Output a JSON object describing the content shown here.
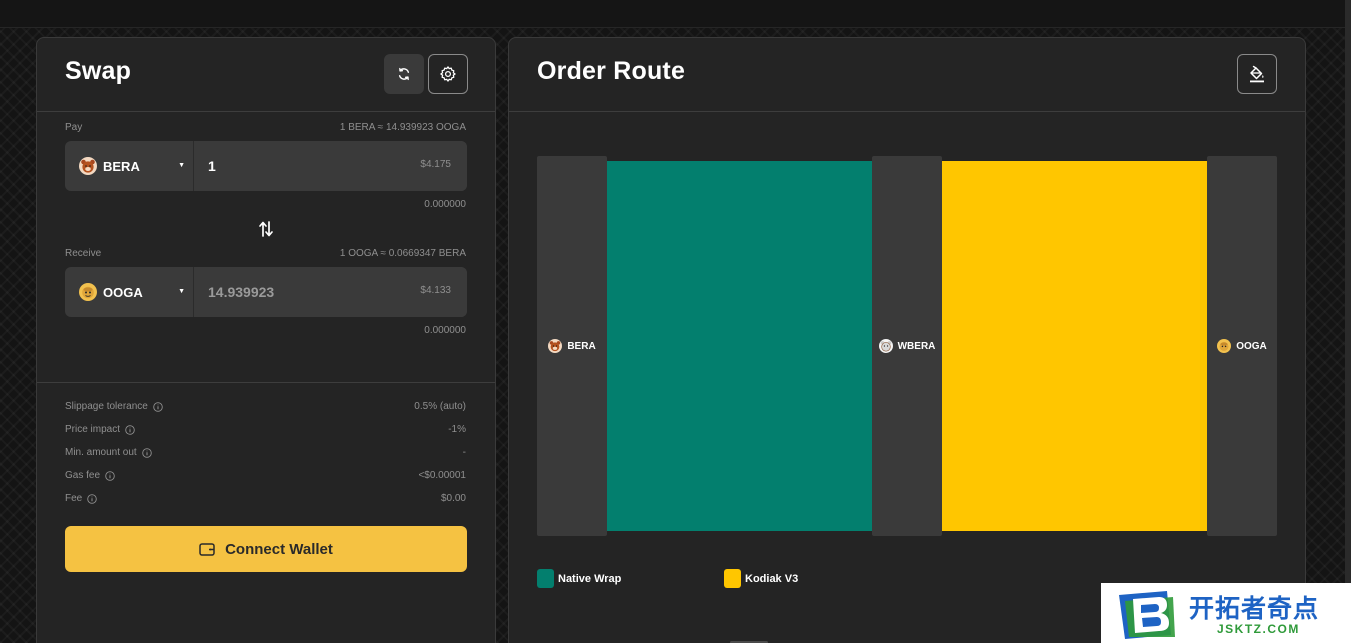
{
  "swap": {
    "title": "Swap",
    "pay": {
      "label": "Pay",
      "rate": "1 BERA ≈ 14.939923 OOGA",
      "token": "BERA",
      "amount": "1",
      "usd": "$4.175",
      "balance": "0.000000"
    },
    "receive": {
      "label": "Receive",
      "rate": "1 OOGA ≈ 0.0669347 BERA",
      "token": "OOGA",
      "amount": "14.939923",
      "usd": "$4.133",
      "balance": "0.000000"
    },
    "details": [
      {
        "label": "Slippage tolerance",
        "value": "0.5% (auto)"
      },
      {
        "label": "Price impact",
        "value": "-1%"
      },
      {
        "label": "Min. amount out",
        "value": "-"
      },
      {
        "label": "Gas fee",
        "value": "<$0.00001"
      },
      {
        "label": "Fee",
        "value": "$0.00"
      }
    ],
    "connect_wallet": "Connect Wallet"
  },
  "route": {
    "title": "Order Route",
    "nodes": [
      "BERA",
      "WBERA",
      "OOGA"
    ],
    "legend": [
      {
        "label": "Native Wrap",
        "color": "#037f6e"
      },
      {
        "label": "Kodiak V3",
        "color": "#ffc600"
      }
    ]
  },
  "watermark": {
    "title": "开拓者奇点",
    "subtitle": "JSKTZ.COM"
  },
  "colors": {
    "accent": "#f5c242",
    "panel": "#242424",
    "native_wrap": "#037f6e",
    "kodiak": "#ffc600"
  }
}
